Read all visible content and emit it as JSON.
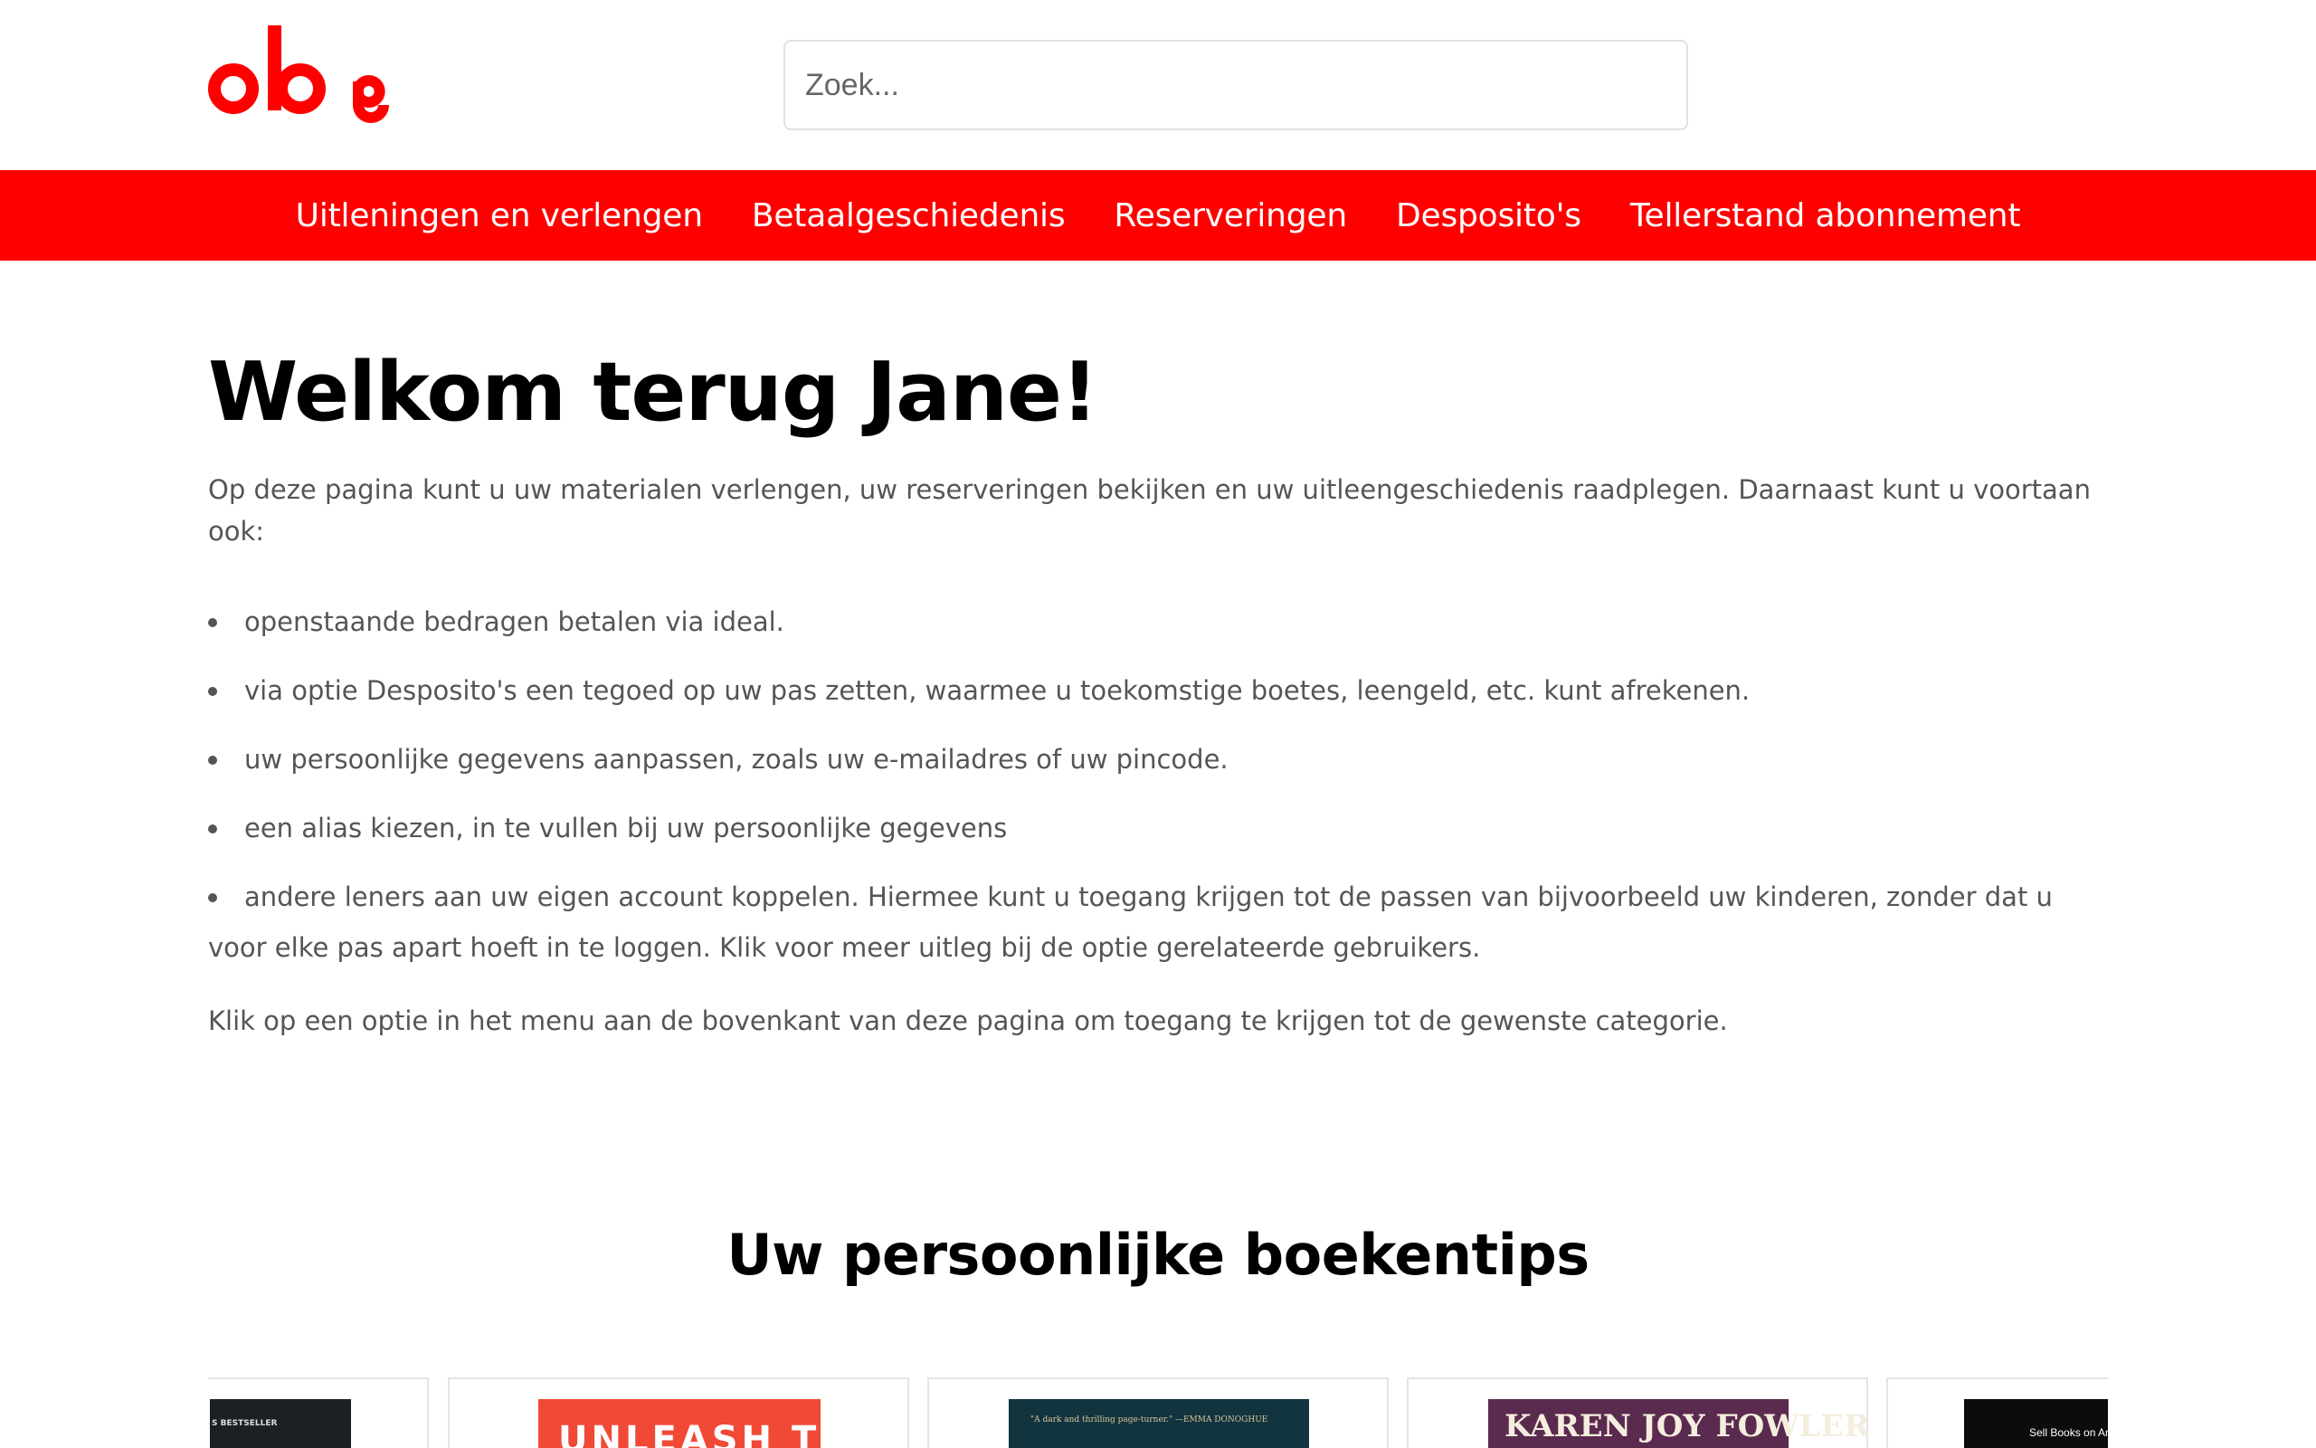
{
  "header": {
    "logo_text": "oba",
    "search_placeholder": "Zoek..."
  },
  "nav": {
    "items": [
      "Uitleningen en verlengen",
      "Betaalgeschiedenis",
      "Reserveringen",
      "Desposito's",
      "Tellerstand abonnement"
    ]
  },
  "main": {
    "title": "Welkom terug Jane!",
    "intro": "Op deze pagina kunt u uw materialen verlengen, uw reserveringen bekijken en uw uitleengeschiedenis raadplegen. Daarnaast kunt u voortaan ook:",
    "bullets": [
      "openstaande bedragen betalen via ideal.",
      "via optie Desposito's een tegoed op uw pas zetten, waarmee u toekomstige boetes, leengeld, etc. kunt afrekenen.",
      "uw persoonlijke gegevens aanpassen, zoals uw e-mailadres of uw pincode.",
      "een alias kiezen, in te vullen bij uw persoonlijke gegevens",
      "andere leners aan uw eigen account koppelen. Hiermee kunt u toegang krijgen tot de passen van bijvoorbeeld uw kinderen, zonder dat u voor elke pas apart hoeft in te loggen. Klik voor meer uitleg bij de optie gerelateerde gebruikers."
    ],
    "outro": "Klik op een optie in het menu aan de bovenkant van deze pagina om toegang te krijgen tot de gewenste categorie."
  },
  "recommendations": {
    "title": "Uw persoonlijke boekentips",
    "covers": [
      {
        "text": "S BESTSELLER",
        "color": "#1c1f24"
      },
      {
        "text": "UNLEASH THE",
        "color": "#f04a36"
      },
      {
        "text": "\"A dark and thrilling page-turner.\" —EMMA DONOGHUE",
        "color": "#12343f"
      },
      {
        "text": "KAREN JOY FOWLER",
        "color": "#5b2a4f"
      },
      {
        "text": "Sell Books on Am",
        "color": "#0c0c0c"
      }
    ]
  },
  "colors": {
    "brand": "#ff0000",
    "nav_text": "#ffffff"
  }
}
